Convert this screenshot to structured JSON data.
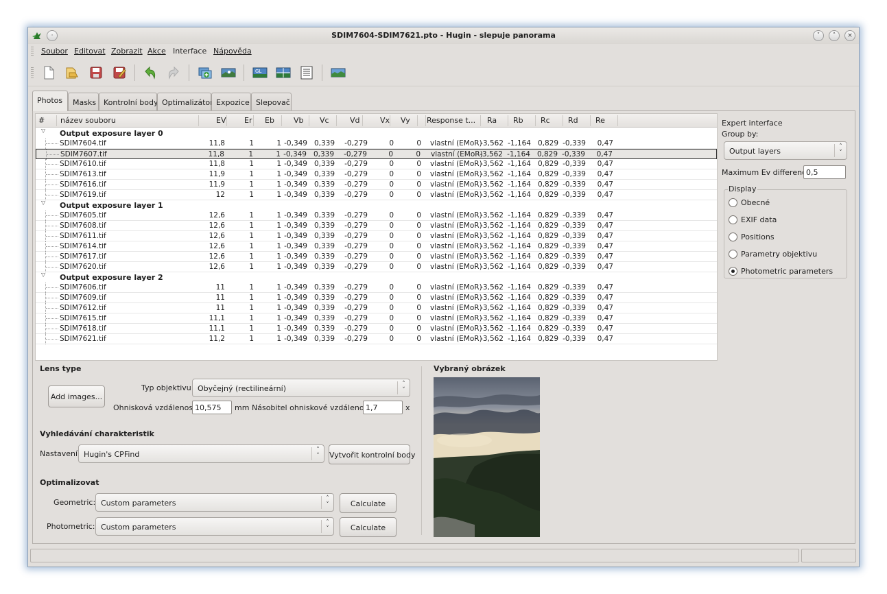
{
  "window": {
    "title": "SDIM7604-SDIM7621.pto - Hugin - slepuje panorama"
  },
  "menu": [
    "Soubor",
    "Editovat",
    "Zobrazit",
    "Akce",
    "Interface",
    "Nápověda"
  ],
  "toolbar_icons": [
    "new-icon",
    "open-icon",
    "save-icon",
    "save-as-icon",
    "undo-icon",
    "redo-icon",
    "add-images-icon",
    "assistant-icon",
    "gl-preview-icon",
    "fast-preview-icon",
    "layout-icon",
    "show-panorama-icon"
  ],
  "tabs": [
    "Photos",
    "Masks",
    "Kontrolní body",
    "Optimalizátor",
    "Expozice",
    "Slepovač"
  ],
  "table": {
    "headers": [
      "#",
      "název souboru",
      "EV",
      "Er",
      "Eb",
      "Vb",
      "Vc",
      "Vd",
      "Vx",
      "Vy",
      "Response t...",
      "Ra",
      "Rb",
      "Rc",
      "Rd",
      "Re"
    ],
    "groups": [
      {
        "label": "Output exposure layer 0",
        "rows": [
          [
            "SDIM7604.tif",
            "11,8",
            "1",
            "1",
            "-0,349",
            "0,339",
            "-0,279",
            "0",
            "0",
            "vlastní (EMoR)",
            "-3,562",
            "-1,164",
            "0,829",
            "-0,339",
            "0,47"
          ],
          [
            "SDIM7607.tif",
            "11,8",
            "1",
            "1",
            "-0,349",
            "0,339",
            "-0,279",
            "0",
            "0",
            "vlastní (EMoR)",
            "-3,562",
            "-1,164",
            "0,829",
            "-0,339",
            "0,47"
          ],
          [
            "SDIM7610.tif",
            "11,8",
            "1",
            "1",
            "-0,349",
            "0,339",
            "-0,279",
            "0",
            "0",
            "vlastní (EMoR)",
            "-3,562",
            "-1,164",
            "0,829",
            "-0,339",
            "0,47"
          ],
          [
            "SDIM7613.tif",
            "11,9",
            "1",
            "1",
            "-0,349",
            "0,339",
            "-0,279",
            "0",
            "0",
            "vlastní (EMoR)",
            "-3,562",
            "-1,164",
            "0,829",
            "-0,339",
            "0,47"
          ],
          [
            "SDIM7616.tif",
            "11,9",
            "1",
            "1",
            "-0,349",
            "0,339",
            "-0,279",
            "0",
            "0",
            "vlastní (EMoR)",
            "-3,562",
            "-1,164",
            "0,829",
            "-0,339",
            "0,47"
          ],
          [
            "SDIM7619.tif",
            "12",
            "1",
            "1",
            "-0,349",
            "0,339",
            "-0,279",
            "0",
            "0",
            "vlastní (EMoR)",
            "-3,562",
            "-1,164",
            "0,829",
            "-0,339",
            "0,47"
          ]
        ]
      },
      {
        "label": "Output exposure layer 1",
        "rows": [
          [
            "SDIM7605.tif",
            "12,6",
            "1",
            "1",
            "-0,349",
            "0,339",
            "-0,279",
            "0",
            "0",
            "vlastní (EMoR)",
            "-3,562",
            "-1,164",
            "0,829",
            "-0,339",
            "0,47"
          ],
          [
            "SDIM7608.tif",
            "12,6",
            "1",
            "1",
            "-0,349",
            "0,339",
            "-0,279",
            "0",
            "0",
            "vlastní (EMoR)",
            "-3,562",
            "-1,164",
            "0,829",
            "-0,339",
            "0,47"
          ],
          [
            "SDIM7611.tif",
            "12,6",
            "1",
            "1",
            "-0,349",
            "0,339",
            "-0,279",
            "0",
            "0",
            "vlastní (EMoR)",
            "-3,562",
            "-1,164",
            "0,829",
            "-0,339",
            "0,47"
          ],
          [
            "SDIM7614.tif",
            "12,6",
            "1",
            "1",
            "-0,349",
            "0,339",
            "-0,279",
            "0",
            "0",
            "vlastní (EMoR)",
            "-3,562",
            "-1,164",
            "0,829",
            "-0,339",
            "0,47"
          ],
          [
            "SDIM7617.tif",
            "12,6",
            "1",
            "1",
            "-0,349",
            "0,339",
            "-0,279",
            "0",
            "0",
            "vlastní (EMoR)",
            "-3,562",
            "-1,164",
            "0,829",
            "-0,339",
            "0,47"
          ],
          [
            "SDIM7620.tif",
            "12,6",
            "1",
            "1",
            "-0,349",
            "0,339",
            "-0,279",
            "0",
            "0",
            "vlastní (EMoR)",
            "-3,562",
            "-1,164",
            "0,829",
            "-0,339",
            "0,47"
          ]
        ]
      },
      {
        "label": "Output exposure layer 2",
        "rows": [
          [
            "SDIM7606.tif",
            "11",
            "1",
            "1",
            "-0,349",
            "0,339",
            "-0,279",
            "0",
            "0",
            "vlastní (EMoR)",
            "-3,562",
            "-1,164",
            "0,829",
            "-0,339",
            "0,47"
          ],
          [
            "SDIM7609.tif",
            "11",
            "1",
            "1",
            "-0,349",
            "0,339",
            "-0,279",
            "0",
            "0",
            "vlastní (EMoR)",
            "-3,562",
            "-1,164",
            "0,829",
            "-0,339",
            "0,47"
          ],
          [
            "SDIM7612.tif",
            "11",
            "1",
            "1",
            "-0,349",
            "0,339",
            "-0,279",
            "0",
            "0",
            "vlastní (EMoR)",
            "-3,562",
            "-1,164",
            "0,829",
            "-0,339",
            "0,47"
          ],
          [
            "SDIM7615.tif",
            "11,1",
            "1",
            "1",
            "-0,349",
            "0,339",
            "-0,279",
            "0",
            "0",
            "vlastní (EMoR)",
            "-3,562",
            "-1,164",
            "0,829",
            "-0,339",
            "0,47"
          ],
          [
            "SDIM7618.tif",
            "11,1",
            "1",
            "1",
            "-0,349",
            "0,339",
            "-0,279",
            "0",
            "0",
            "vlastní (EMoR)",
            "-3,562",
            "-1,164",
            "0,829",
            "-0,339",
            "0,47"
          ],
          [
            "SDIM7621.tif",
            "11,2",
            "1",
            "1",
            "-0,349",
            "0,339",
            "-0,279",
            "0",
            "0",
            "vlastní (EMoR)",
            "-3,562",
            "-1,164",
            "0,829",
            "-0,339",
            "0,47"
          ]
        ]
      }
    ],
    "selected_file": "SDIM7607.tif"
  },
  "side": {
    "expert_label": "Expert interface",
    "group_by_label": "Group by:",
    "group_by_value": "Output layers",
    "max_ev_label": "Maximum Ev difference:",
    "max_ev_value": "0,5",
    "display_title": "Display",
    "display_options": [
      "Obecné",
      "EXIF data",
      "Positions",
      "Parametry objektivu",
      "Photometric parameters"
    ],
    "display_selected": "Photometric parameters"
  },
  "lens": {
    "title": "Lens type",
    "add_images": "Add images...",
    "type_label": "Typ objektivu:",
    "type_value": "Obyčejný (rectilineární)",
    "focal_label": "Ohnisková vzdálenost:",
    "focal_value": "10,575",
    "focal_unit": "mm",
    "crop_label": "Násobitel ohniskové vzdálenosti:",
    "crop_value": "1,7",
    "crop_unit": "x"
  },
  "features": {
    "title": "Vyhledávání charakteristik",
    "setting_label": "Nastavení:",
    "setting_value": "Hugin's CPFind",
    "create_button": "Vytvořit kontrolní body"
  },
  "optimize": {
    "title": "Optimalizovat",
    "geometric_label": "Geometric:",
    "geometric_value": "Custom parameters",
    "photometric_label": "Photometric:",
    "photometric_value": "Custom parameters",
    "calculate": "Calculate"
  },
  "preview": {
    "title": "Vybraný obrázek"
  },
  "colors": {
    "window_bg": "#e2dfdc",
    "selected_row_border": "#333333",
    "window_glow": "#3c6eaa"
  }
}
